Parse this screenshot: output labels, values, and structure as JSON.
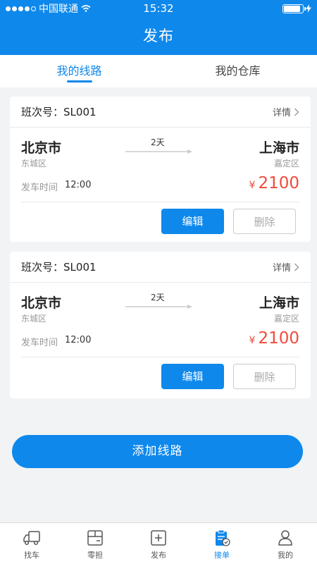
{
  "status_bar": {
    "carrier": "中国联通",
    "time": "15:32",
    "signal_bars": 4,
    "battery_level": 0.9
  },
  "header": {
    "title": "发布"
  },
  "tabs": [
    {
      "label": "我的线路",
      "active": true
    },
    {
      "label": "我的仓库",
      "active": false
    }
  ],
  "routes": [
    {
      "shift_label": "班次号：",
      "shift_no": "SL001",
      "detail_label": "详情",
      "from_city": "北京市",
      "from_district": "东城区",
      "to_city": "上海市",
      "to_district": "嘉定区",
      "duration": "2天",
      "departure_label": "发车时间",
      "departure_time": "12:00",
      "currency": "¥",
      "price": "2100",
      "edit_label": "编辑",
      "delete_label": "删除"
    },
    {
      "shift_label": "班次号：",
      "shift_no": "SL001",
      "detail_label": "详情",
      "from_city": "北京市",
      "from_district": "东城区",
      "to_city": "上海市",
      "to_district": "嘉定区",
      "duration": "2天",
      "departure_label": "发车时间",
      "departure_time": "12:00",
      "currency": "¥",
      "price": "2100",
      "edit_label": "编辑",
      "delete_label": "删除"
    }
  ],
  "add_button": {
    "label": "添加线路"
  },
  "bottom_nav": [
    {
      "label": "找车",
      "icon": "truck-icon",
      "active": false
    },
    {
      "label": "零担",
      "icon": "box-icon",
      "active": false
    },
    {
      "label": "发布",
      "icon": "plus-square-icon",
      "active": false
    },
    {
      "label": "接单",
      "icon": "clipboard-check-icon",
      "active": true
    },
    {
      "label": "我的",
      "icon": "user-icon",
      "active": false
    }
  ],
  "colors": {
    "primary": "#0f88eb",
    "price": "#f04a3a",
    "background": "#f2f3f5"
  }
}
